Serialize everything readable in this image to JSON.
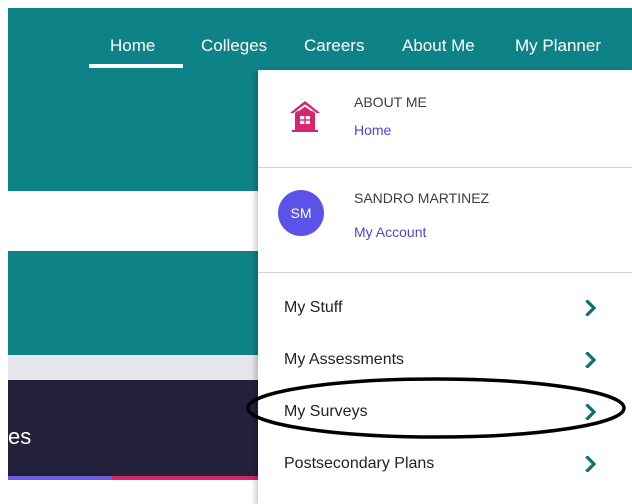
{
  "nav": {
    "items": [
      {
        "label": "Home",
        "active": true
      },
      {
        "label": "Colleges"
      },
      {
        "label": "Careers"
      },
      {
        "label": "About Me"
      },
      {
        "label": "My Planner"
      }
    ]
  },
  "background": {
    "partial_heading": "es"
  },
  "menu": {
    "about_section": {
      "heading": "ABOUT ME",
      "link": "Home",
      "icon": "house-icon"
    },
    "user_section": {
      "avatar_initials": "SM",
      "name": "SANDRO MARTINEZ",
      "link": "My Account"
    },
    "items": [
      {
        "label": "My Stuff"
      },
      {
        "label": "My Assessments"
      },
      {
        "label": "My Surveys",
        "highlighted": true
      },
      {
        "label": "Postsecondary Plans"
      }
    ]
  },
  "colors": {
    "teal": "#0e8387",
    "purple_link": "#5a3fd6",
    "avatar": "#5b52e8",
    "house_icon": "#d6246e",
    "chevron": "#0e6e73",
    "dark_band": "#22203b"
  }
}
